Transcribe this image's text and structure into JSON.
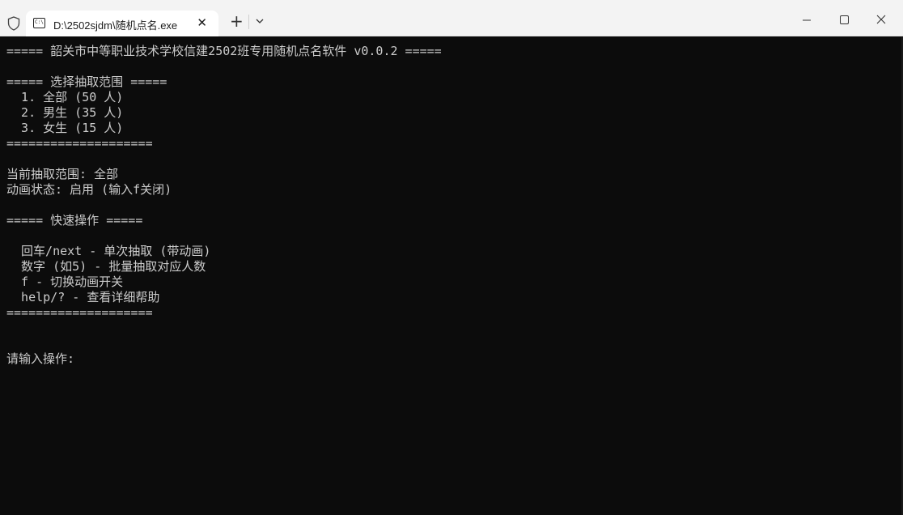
{
  "window": {
    "tab_title": "D:\\2502sjdm\\随机点名.exe",
    "tab_icon_text": "C:\\",
    "new_tab_label": "+",
    "close_tab_label": "✕"
  },
  "terminal": {
    "lines": [
      "===== 韶关市中等职业技术学校信建2502班专用随机点名软件 v0.0.2 =====",
      "",
      "===== 选择抽取范围 =====",
      "  1. 全部 (50 人)",
      "  2. 男生 (35 人)",
      "  3. 女生 (15 人)",
      "====================",
      "",
      "当前抽取范围: 全部",
      "动画状态: 启用 (输入f关闭)",
      "",
      "===== 快速操作 =====",
      "",
      "  回车/next - 单次抽取 (带动画)",
      "  数字 (如5) - 批量抽取对应人数",
      "  f - 切换动画开关",
      "  help/? - 查看详细帮助",
      "====================",
      "",
      "",
      "请输入操作:"
    ]
  }
}
